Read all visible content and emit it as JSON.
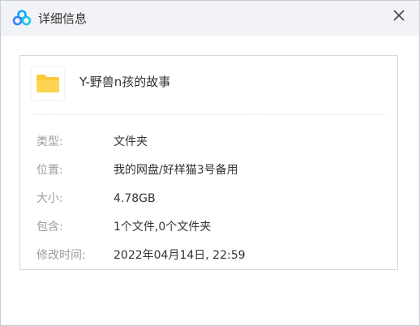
{
  "window": {
    "title": "详细信息",
    "close_glyph": "✕",
    "logo_icon": "cloud-logo-icon",
    "accent_color": "#06a7ff"
  },
  "file": {
    "icon": "folder-icon",
    "icon_color": "#ffc93b",
    "name": "Y-野兽n孩的故事"
  },
  "details": [
    {
      "label": "类型:",
      "value": "文件夹"
    },
    {
      "label": "位置:",
      "value": "我的网盘/好样猫3号备用"
    },
    {
      "label": "大小:",
      "value": "4.78GB"
    },
    {
      "label": "包含:",
      "value": "1个文件,0个文件夹"
    },
    {
      "label": "修改时间:",
      "value": "2022年04月14日, 22:59"
    }
  ]
}
